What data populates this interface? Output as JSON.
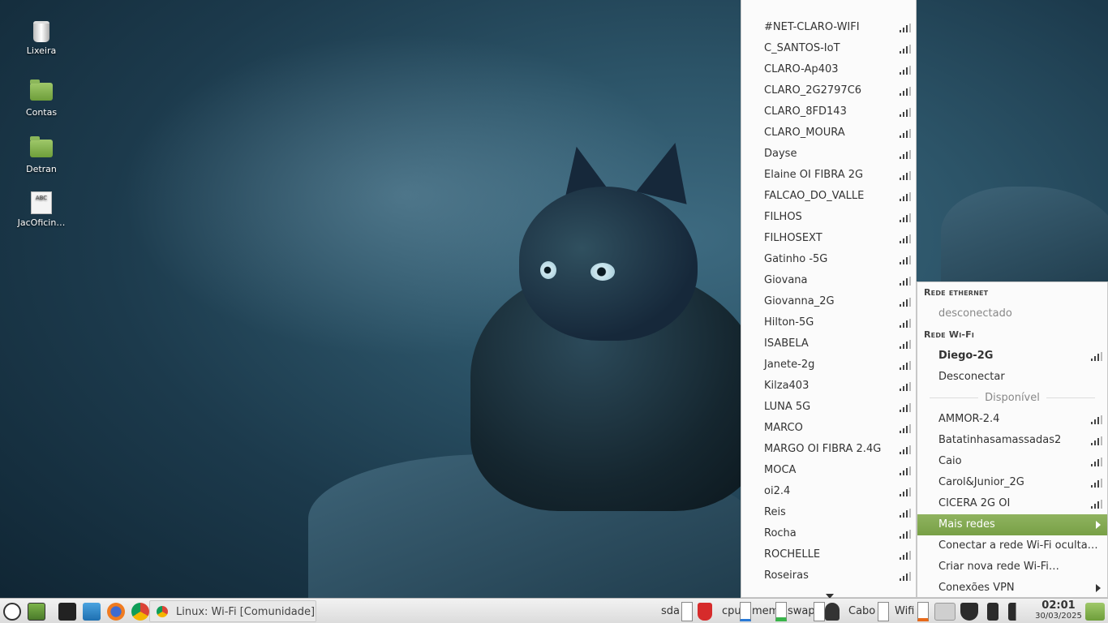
{
  "desktop": {
    "icons": [
      {
        "label": "Lixeira",
        "icon": "trash-icon"
      },
      {
        "label": "Contas",
        "icon": "folder-icon"
      },
      {
        "label": "Detran",
        "icon": "folder-icon"
      },
      {
        "label": "JacOficin…",
        "icon": "document-icon"
      }
    ]
  },
  "more_networks": [
    "#NET-CLARO-WIFI",
    "C_SANTOS-IoT",
    "CLARO-Ap403",
    "CLARO_2G2797C6",
    "CLARO_8FD143",
    "CLARO_MOURA",
    "Dayse",
    "Elaine OI FIBRA 2G",
    "FALCAO_DO_VALLE",
    "FILHOS",
    "FILHOSEXT",
    "Gatinho -5G",
    "Giovana",
    "Giovanna_2G",
    "Hilton-5G",
    "ISABELA",
    "Janete-2g",
    "Kilza403",
    "LUNA 5G",
    "MARCO",
    "MARGO OI FIBRA 2.4G",
    "MOCA",
    "oi2.4",
    "Reis",
    "Rocha",
    "ROCHELLE",
    "Roseiras"
  ],
  "network_menu": {
    "ethernet_header": "Rede ethernet",
    "ethernet_status": "desconectado",
    "wifi_header": "Rede Wi-Fi",
    "connected_network": "Diego-2G",
    "disconnect": "Desconectar",
    "available_label": "Disponível",
    "available": [
      "AMMOR-2.4",
      "Batatinhasamassadas2",
      "Caio",
      "Carol&Junior_2G",
      "CICERA 2G OI"
    ],
    "more_networks": "Mais redes",
    "connect_hidden": "Conectar a rede Wi-Fi oculta…",
    "create_new": "Criar nova rede Wi-Fi…",
    "vpn": "Conexões VPN"
  },
  "taskbar": {
    "window_title": "Linux: Wi-Fi [Comunidade] …",
    "sda": "sda",
    "cpu": "cpu",
    "mem": "mem",
    "swap": "swap",
    "cabo": "Cabo",
    "wifi": "Wifi",
    "time": "02:01",
    "date": "30/03/2025"
  },
  "colors": {
    "accent": "#78a046",
    "menu_bg": "#fbfbfb",
    "taskbar_bg": "#e4e4e4"
  }
}
